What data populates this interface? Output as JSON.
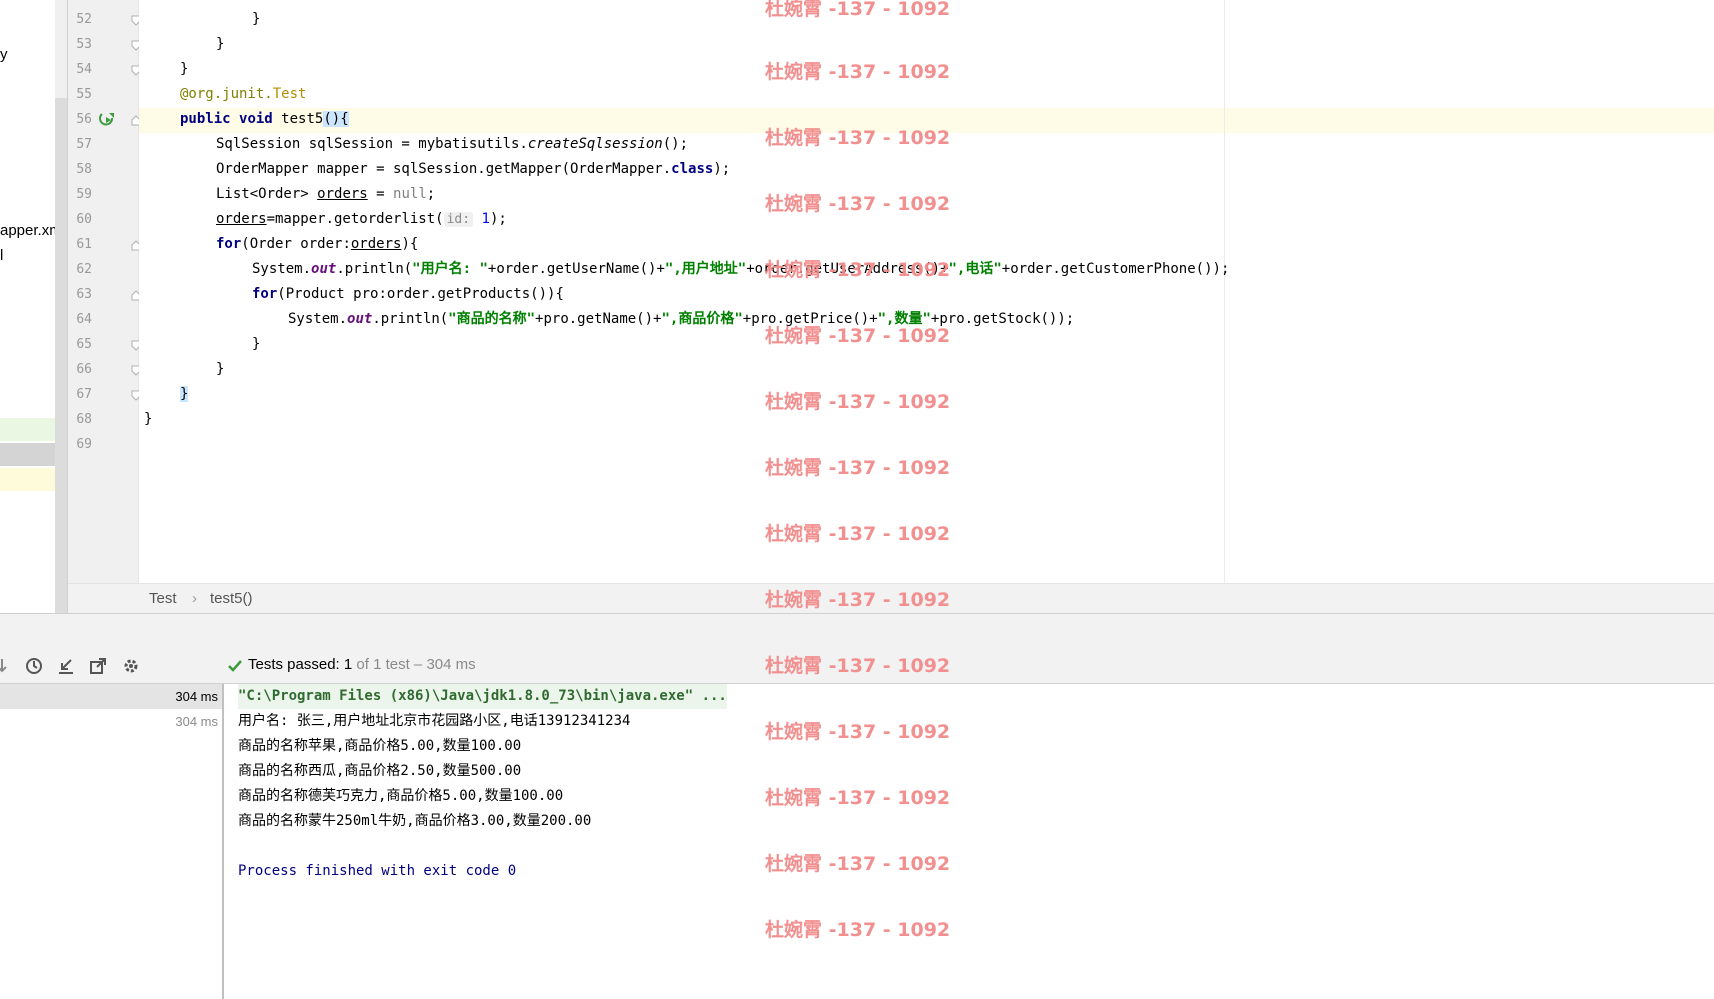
{
  "project_panel": {
    "fragments": [
      "y",
      "apper.xm",
      "l"
    ]
  },
  "editor": {
    "line_numbers": [
      "52",
      "53",
      "54",
      "55",
      "56",
      "57",
      "58",
      "59",
      "60",
      "61",
      "62",
      "63",
      "64",
      "65",
      "66",
      "67",
      "68",
      "69"
    ],
    "line52": "}",
    "line53": "}",
    "line54": "}",
    "line55_at": "@org.junit.",
    "line55_test": "Test",
    "line56_kw1": "public",
    "line56_kw2": "void",
    "line56_name": "test5",
    "line56_paren": "()",
    "line56_brace": "{",
    "line57_a": "SqlSession sqlSession = mybatisutils.",
    "line57_b": "createSqlsession",
    "line57_c": "();",
    "line58_a": "OrderMapper mapper = sqlSession.getMapper(OrderMapper.",
    "line58_b": "class",
    "line58_c": ");",
    "line59_a": "List<Order> ",
    "line59_b": "orders",
    "line59_c": " = ",
    "line59_d": "null",
    "line59_e": ";",
    "line60_a": "orders",
    "line60_b": "=mapper.getorderlist(",
    "line60_hint": "id:",
    "line60_num": "1",
    "line60_c": ");",
    "line61_kw": "for",
    "line61_a": "(Order order:",
    "line61_b": "orders",
    "line61_c": "){",
    "line62_a": "System.",
    "line62_out": "out",
    "line62_b": ".println(",
    "line62_s1": "\"用户名: \"",
    "line62_c": "+order.getUserName()+",
    "line62_s2": "\",用户地址\"",
    "line62_d": "+order.getUserAddress()+",
    "line62_s3": "\",电话\"",
    "line62_e": "+order.getCustomerPhone());",
    "line63_kw": "for",
    "line63_a": "(Product pro:order.getProducts()){",
    "line64_a": "System.",
    "line64_out": "out",
    "line64_b": ".println(",
    "line64_s1": "\"商品的名称\"",
    "line64_c": "+pro.getName()+",
    "line64_s2": "\",商品价格\"",
    "line64_d": "+pro.getPrice()+",
    "line64_s3": "\",数量\"",
    "line64_e": "+pro.getStock());",
    "line65": "}",
    "line66": "}",
    "line67": "}",
    "line68": "}"
  },
  "breadcrumb": {
    "class_name": "Test",
    "separator": "›",
    "method_name": "test5()"
  },
  "run_panel": {
    "status_main": "Tests passed: ",
    "status_count": "1",
    "status_rest": " of 1 test – 304 ms",
    "tree_rows": [
      {
        "time": "304 ms"
      },
      {
        "time": "304 ms"
      }
    ],
    "console_lines": [
      "\"C:\\Program Files (x86)\\Java\\jdk1.8.0_73\\bin\\java.exe\" ...",
      "用户名: 张三,用户地址北京市花园路小区,电话13912341234",
      "商品的名称苹果,商品价格5.00,数量100.00",
      "商品的名称西瓜,商品价格2.50,数量500.00",
      "商品的名称德芙巧克力,商品价格5.00,数量100.00",
      "商品的名称蒙牛250ml牛奶,商品价格3.00,数量200.00",
      "",
      "Process finished with exit code 0"
    ],
    "icons": [
      "down-arrow-icon",
      "history-icon",
      "import-icon",
      "export-icon",
      "settings-gear-icon"
    ]
  },
  "watermark": {
    "text": "杜婉霄 -137 - 1092"
  },
  "colors": {
    "keyword": "#000080",
    "string": "#008000",
    "field": "#660e7a",
    "annotation": "#808000",
    "caret_line": "#fefbe6",
    "watermark": "#f28a8a",
    "success_check": "#3d9a3d"
  }
}
